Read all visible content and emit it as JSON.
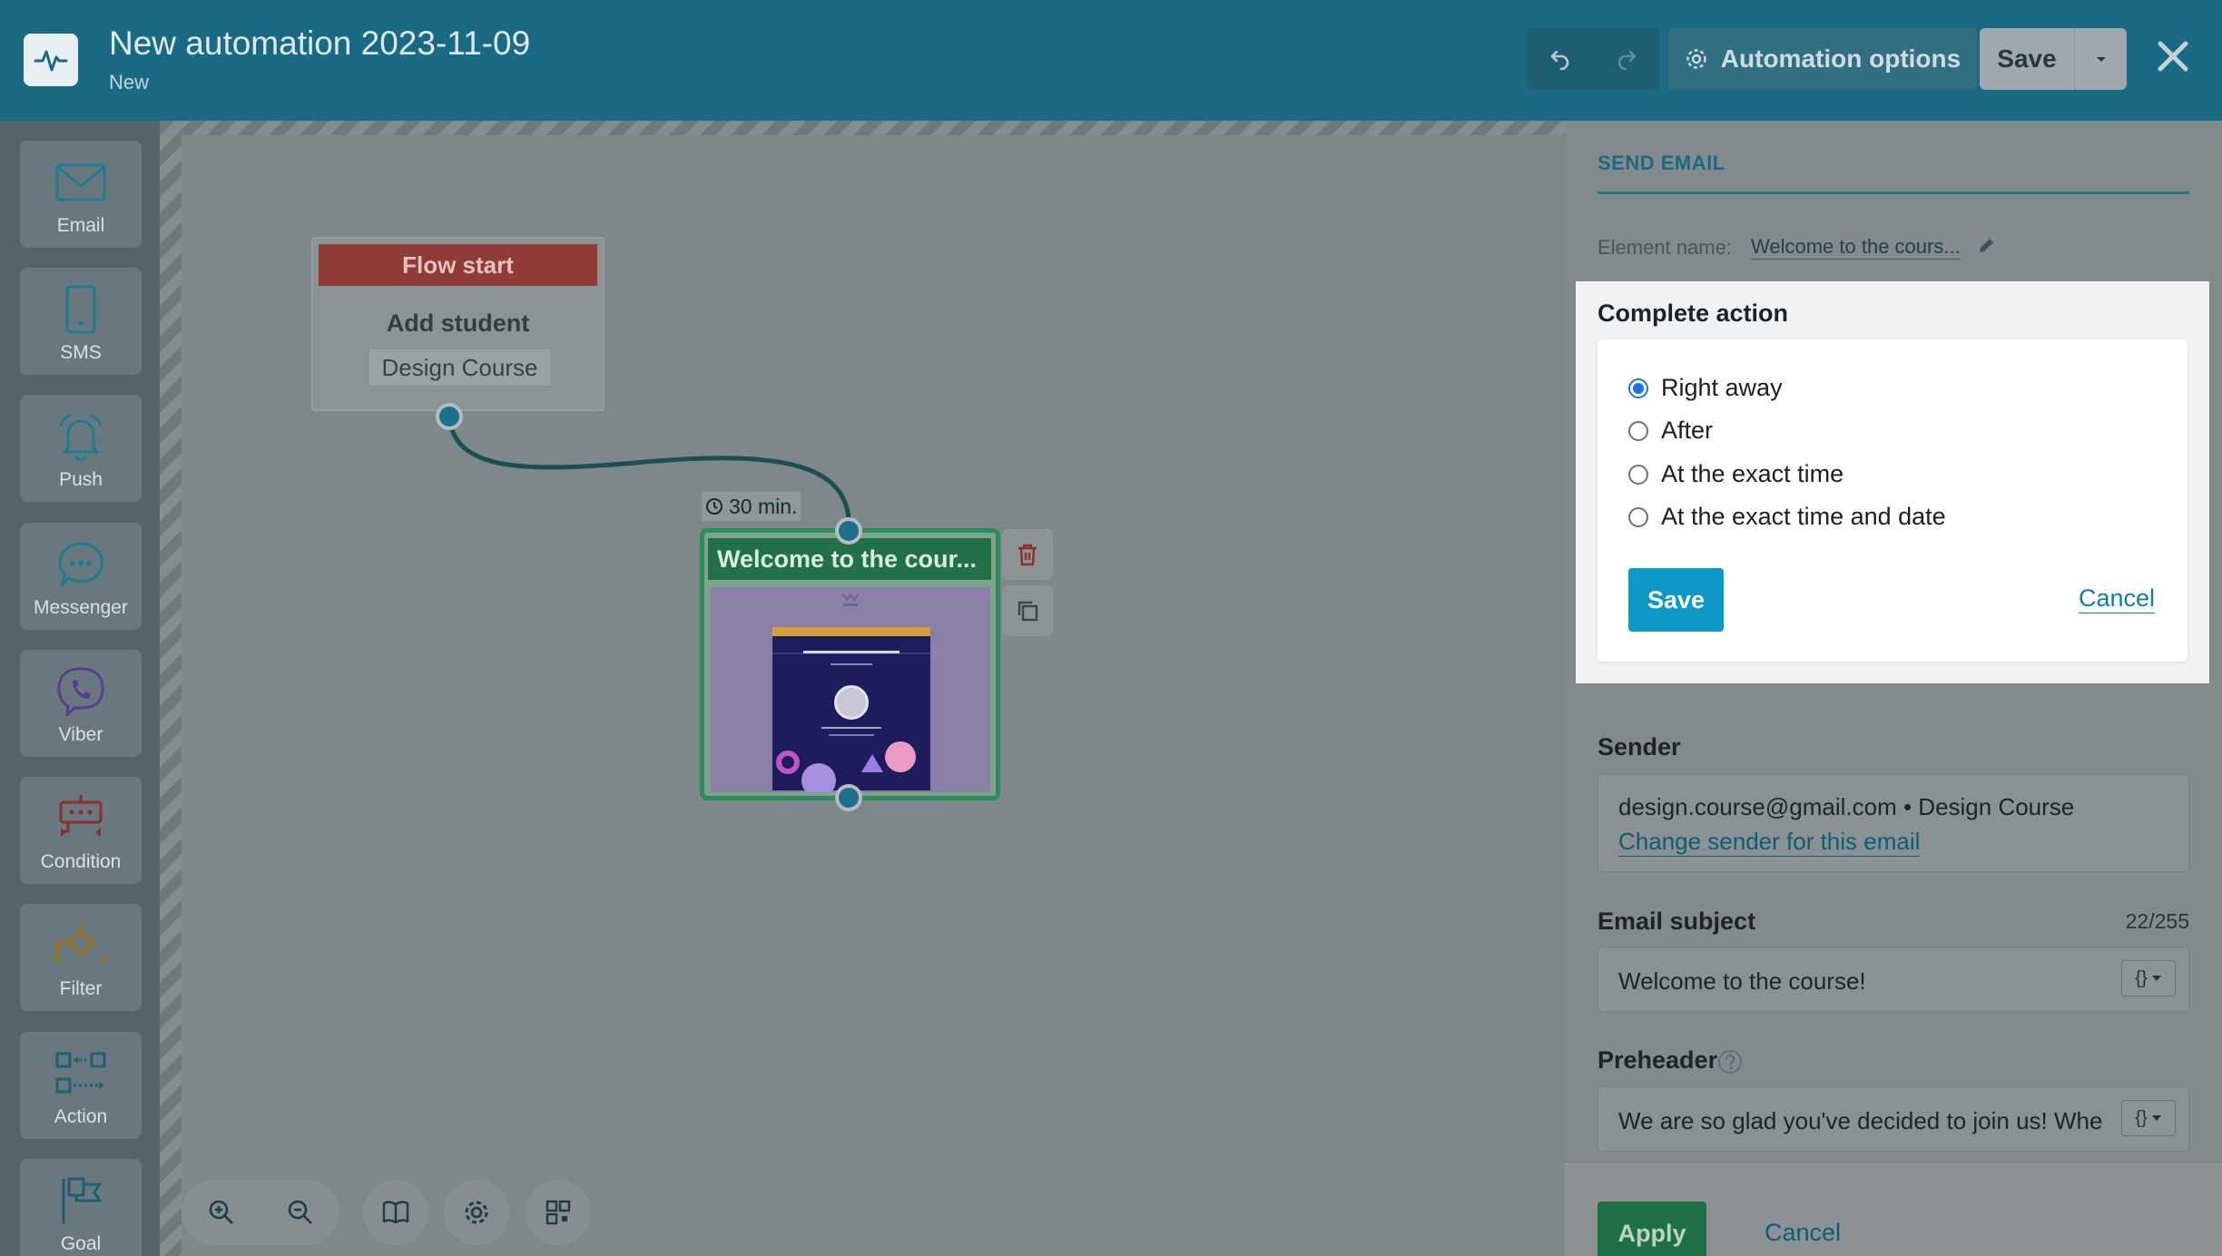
{
  "header": {
    "title": "New automation 2023-11-09",
    "status": "New",
    "automation_options_label": "Automation options",
    "save_label": "Save"
  },
  "palette": {
    "items": [
      {
        "label": "Email",
        "icon": "envelope-icon"
      },
      {
        "label": "SMS",
        "icon": "phone-icon"
      },
      {
        "label": "Push",
        "icon": "bell-icon"
      },
      {
        "label": "Messenger",
        "icon": "chat-bubble-icon"
      },
      {
        "label": "Viber",
        "icon": "viber-icon"
      },
      {
        "label": "Condition",
        "icon": "condition-icon"
      },
      {
        "label": "Filter",
        "icon": "filter-icon"
      },
      {
        "label": "Action",
        "icon": "action-icon"
      },
      {
        "label": "Goal",
        "icon": "flag-icon"
      }
    ]
  },
  "canvas": {
    "flow_start": {
      "header": "Flow start",
      "action": "Add student",
      "course": "Design Course"
    },
    "delay_label": "30 min.",
    "email_node": {
      "title": "Welcome to the cour..."
    }
  },
  "panel": {
    "tab_label": "SEND EMAIL",
    "element_name_label": "Element name:",
    "element_name_value": "Welcome to the cours...",
    "sender_label": "Sender",
    "sender_value": "design.course@gmail.com • Design Course",
    "change_sender_link": "Change sender for this email",
    "subject_label": "Email subject",
    "subject_count": "22/255",
    "subject_value": "Welcome to the course!",
    "preheader_label": "Preheader",
    "preheader_value": "We are so glad you've decided to join us! Whe",
    "apply_label": "Apply",
    "cancel_label": "Cancel"
  },
  "complete_action": {
    "title": "Complete action",
    "options": [
      {
        "label": "Right away",
        "selected": true
      },
      {
        "label": "After",
        "selected": false
      },
      {
        "label": "At the exact time",
        "selected": false
      },
      {
        "label": "At the exact time and date",
        "selected": false
      }
    ],
    "save_label": "Save",
    "cancel_label": "Cancel"
  },
  "colors": {
    "header_bg": "#1b6a83",
    "accent_blue": "#0e98c7",
    "flow_start_red": "#8f3c39",
    "email_green": "#217048",
    "radio_selected": "#1a73e8"
  }
}
